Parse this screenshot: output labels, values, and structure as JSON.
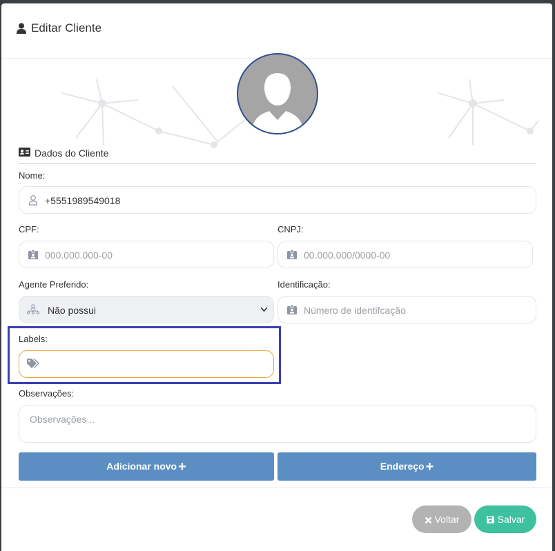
{
  "modal": {
    "title": "Editar Cliente"
  },
  "section": {
    "title": "Dados do Cliente"
  },
  "fields": {
    "nome": {
      "label": "Nome:",
      "value": "+5551989549018"
    },
    "cpf": {
      "label": "CPF:",
      "placeholder": "000.000.000-00"
    },
    "cnpj": {
      "label": "CNPJ:",
      "placeholder": "00.000.000/0000-00"
    },
    "agente": {
      "label": "Agente Preferido:",
      "value": "Não possui"
    },
    "identificacao": {
      "label": "Identificação:",
      "placeholder": "Número de identifcação"
    },
    "labels": {
      "label": "Labels:"
    },
    "observacoes": {
      "label": "Observações:",
      "placeholder": "Observações..."
    }
  },
  "buttons": {
    "adicionar_novo": "Adicionar novo",
    "endereco": "Endereço",
    "voltar": "Voltar",
    "salvar": "Salvar"
  },
  "colors": {
    "accent_blue": "#5b8fc3",
    "save_green": "#3ec19f",
    "cancel_gray": "#b3b3b3",
    "labels_focus": "#f0a339",
    "highlight": "#3b3fb3"
  }
}
